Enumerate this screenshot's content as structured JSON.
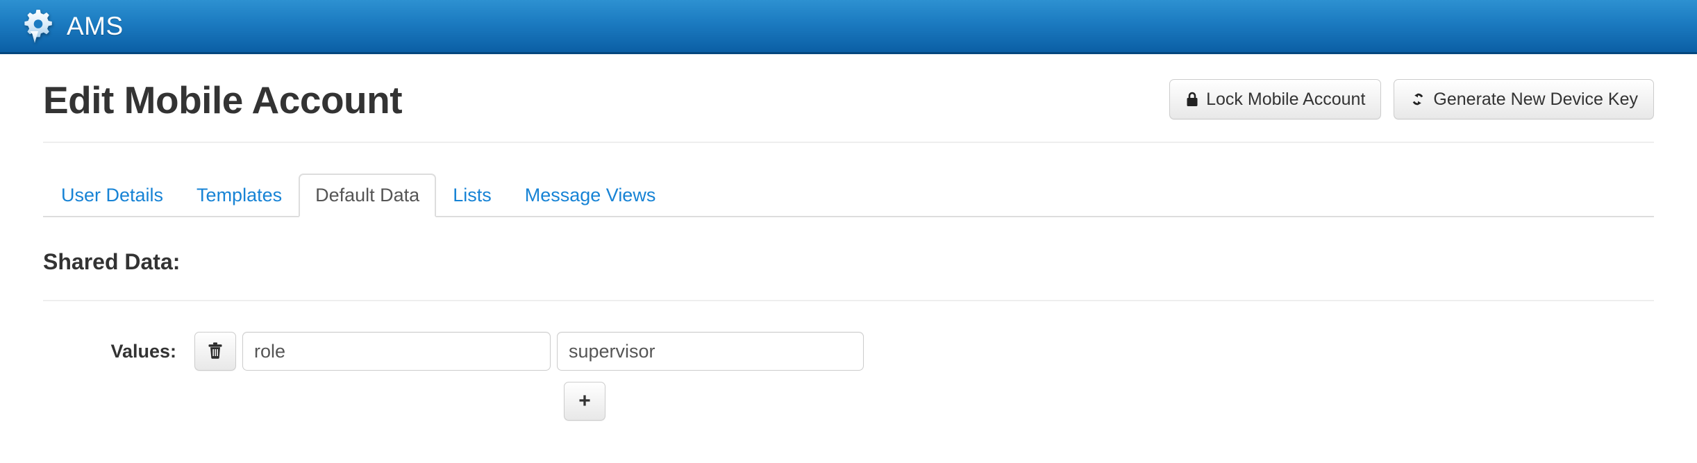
{
  "navbar": {
    "brand_label": "AMS",
    "logo_icon": "gear-speech-bubble-icon",
    "gradient_top": "#2d91d1",
    "gradient_bottom": "#0b5fa5"
  },
  "page": {
    "title": "Edit Mobile Account",
    "actions": [
      {
        "label": "Lock Mobile Account",
        "icon": "lock-icon"
      },
      {
        "label": "Generate New Device Key",
        "icon": "refresh-icon"
      }
    ]
  },
  "tabs": [
    {
      "label": "User Details",
      "active": false
    },
    {
      "label": "Templates",
      "active": false
    },
    {
      "label": "Default Data",
      "active": true
    },
    {
      "label": "Lists",
      "active": false
    },
    {
      "label": "Message Views",
      "active": false
    }
  ],
  "shared_data": {
    "heading": "Shared Data:",
    "values_label": "Values:",
    "rows": [
      {
        "key": "role",
        "value": "supervisor",
        "key_placeholder": "",
        "value_placeholder": "",
        "delete_icon": "trash-icon"
      }
    ],
    "add_label": "+",
    "add_icon": "plus-icon"
  },
  "colors": {
    "link": "#1783d5",
    "text": "#333333",
    "border": "#cccccc",
    "rule": "#eeeeee"
  }
}
